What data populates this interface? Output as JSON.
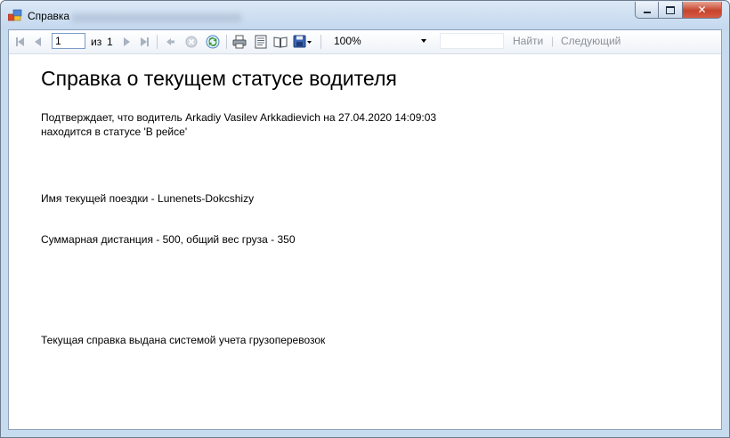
{
  "window": {
    "title": "Справка"
  },
  "toolbar": {
    "page_current": "1",
    "page_of_label": "из",
    "page_total": "1",
    "zoom_value": "100%",
    "search_value": "",
    "find_label": "Найти",
    "separator": "|",
    "next_label": "Следующий"
  },
  "report": {
    "title": "Справка о текущем статусе водителя",
    "confirm_line1": "Подтверждает, что водитель Arkadiy Vasilev Arkkadievich на 27.04.2020 14:09:03",
    "confirm_line2": "находится в статусе 'В рейсе'",
    "trip_line": "Имя текущей поездки - Lunenets-Dokcshizy",
    "distance_line": "Суммарная дистанция - 500, общий вес груза - 350",
    "footer_line": "Текущая справка выдана системой учета грузоперевозок"
  },
  "icons": {
    "first": "first-page-icon",
    "prev": "previous-page-icon",
    "next": "next-page-icon",
    "last": "last-page-icon",
    "back": "back-icon",
    "stop": "stop-icon",
    "refresh": "refresh-icon",
    "print": "print-icon",
    "layout": "print-layout-icon",
    "setup": "page-setup-icon",
    "export": "export-icon"
  },
  "colors": {
    "titlebar": "#c4d8ee",
    "close_button": "#c7432c",
    "link_disabled": "#8a9097",
    "refresh_green": "#3a9a3a"
  }
}
